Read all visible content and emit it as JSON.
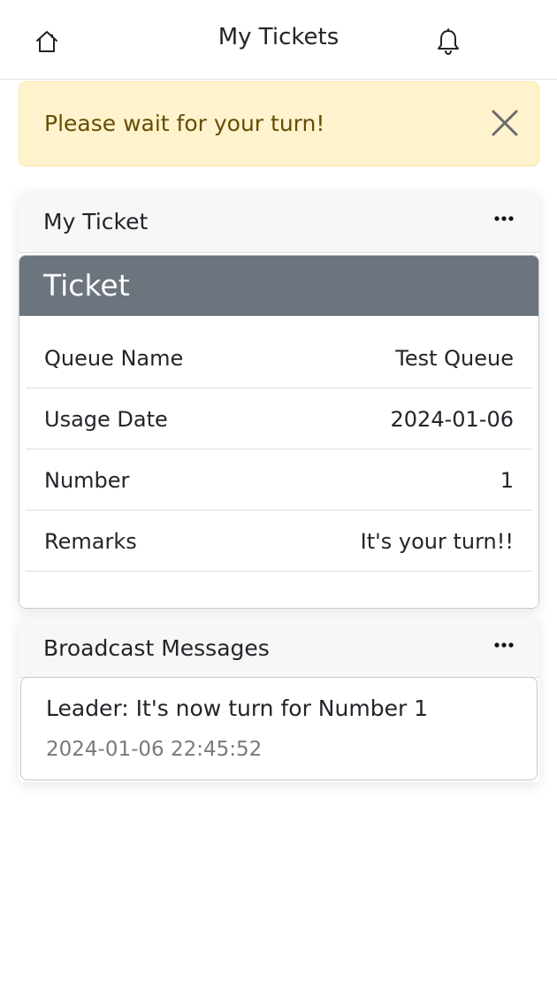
{
  "header": {
    "title": "My Tickets",
    "home_icon": "home-icon",
    "bell_icon": "bell-icon"
  },
  "alert": {
    "text": "Please wait for your turn!",
    "close_icon": "close-icon",
    "colors": {
      "background": "#fff3cd",
      "border": "#ffe69c",
      "text": "#664d03"
    }
  },
  "my_ticket": {
    "title": "My Ticket",
    "more_icon": "more-horizontal-icon",
    "card_title": "Ticket",
    "card_header_color": "#6c757d",
    "rows": [
      {
        "label": "Queue Name",
        "value": "Test Queue"
      },
      {
        "label": "Usage Date",
        "value": "2024-01-06"
      },
      {
        "label": "Number",
        "value": "1"
      },
      {
        "label": "Remarks",
        "value": "It's your turn!!"
      }
    ]
  },
  "broadcast": {
    "title": "Broadcast Messages",
    "more_icon": "more-horizontal-icon",
    "messages": [
      {
        "text": "Leader: It's now turn for Number 1",
        "time": "2024-01-06 22:45:52"
      }
    ]
  }
}
